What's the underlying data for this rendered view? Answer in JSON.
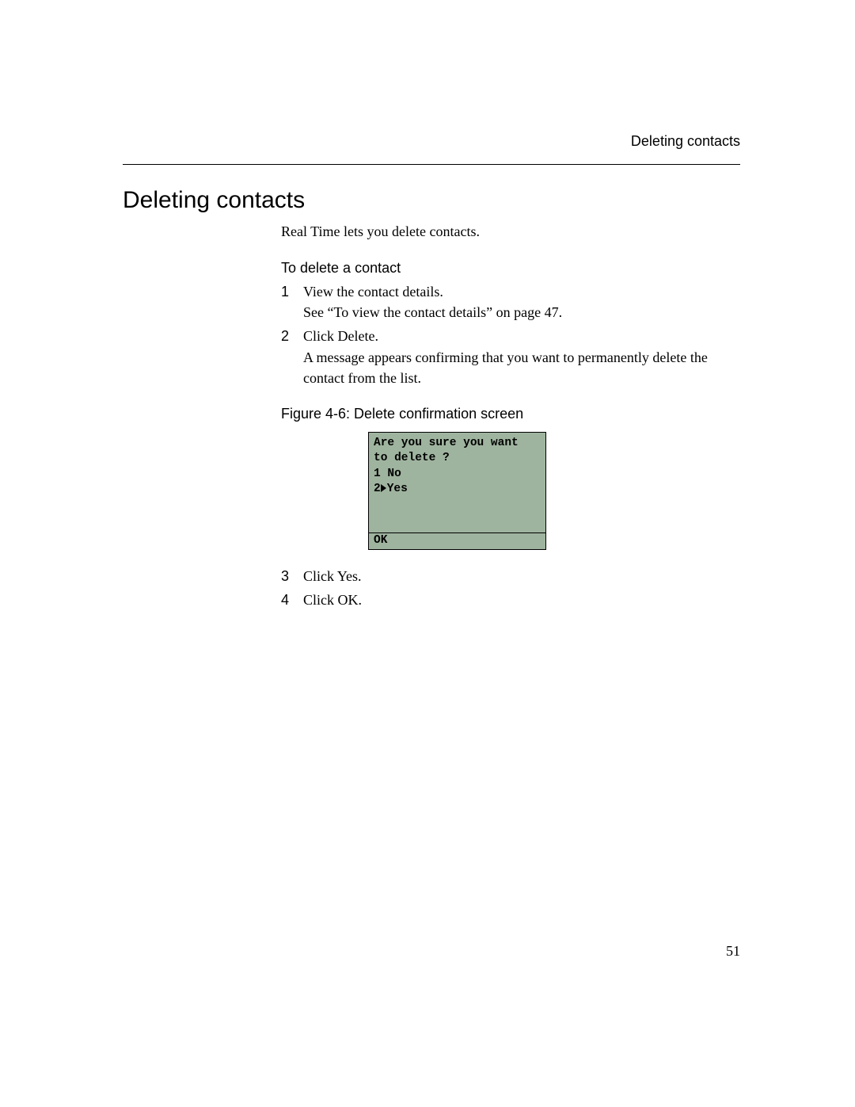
{
  "header": {
    "running": "Deleting contacts"
  },
  "section": {
    "title": "Deleting contacts",
    "intro": "Real Time lets you delete contacts.",
    "subhead": "To delete a contact",
    "steps": [
      {
        "num": "1",
        "text": "View the contact details.",
        "extra": "See “To view the contact details” on page 47."
      },
      {
        "num": "2",
        "text": "Click Delete.",
        "extra": "A message appears confirming that you want to permanently delete the contact from the list."
      },
      {
        "num": "3",
        "text": "Click Yes."
      },
      {
        "num": "4",
        "text": "Click OK."
      }
    ]
  },
  "figure": {
    "caption": "Figure 4-6: Delete confirmation screen",
    "screen": {
      "line1": "Are you sure you want",
      "line2": "to delete ?",
      "opt1_num": "1",
      "opt1_label": "No",
      "opt2_num": "2",
      "opt2_label": "Yes",
      "softkey": "OK"
    }
  },
  "page_number": "51"
}
